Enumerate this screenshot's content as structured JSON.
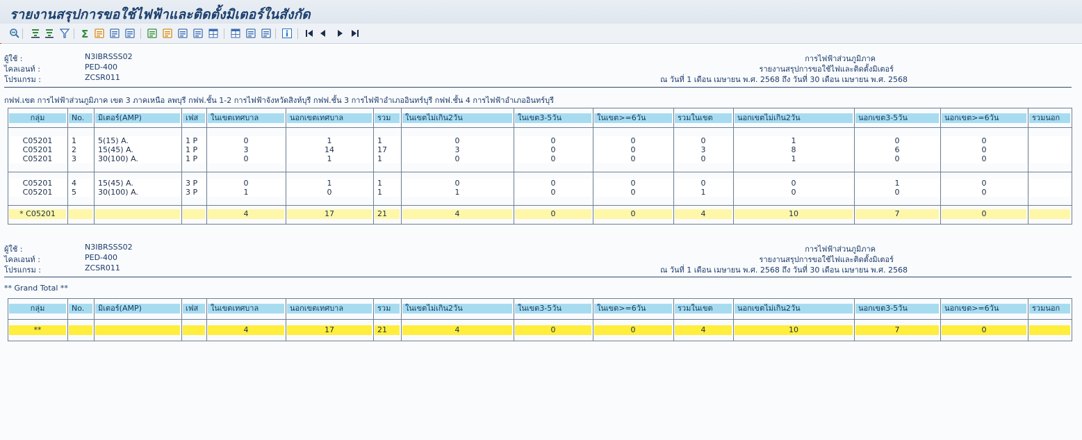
{
  "window": {
    "title": "รายงานสรุปการขอใช้ไฟฟ้าและติดตั้งมิเตอร์ในสังกัด"
  },
  "toolbar": {
    "icons": [
      "details-icon",
      "sort-ascending-icon",
      "sort-descending-icon",
      "filter-icon",
      "sum-icon",
      "subtotal-icon",
      "print-preview-icon",
      "layout-icon",
      "export-spreadsheet-icon",
      "download-icon",
      "send-mail-icon",
      "graphic-icon",
      "abc-analysis-icon",
      "change-layout-icon",
      "select-layout-icon",
      "save-layout-icon",
      "information-icon",
      "first-page-icon",
      "previous-page-icon",
      "next-page-icon",
      "last-page-icon"
    ]
  },
  "header_block_1": {
    "user_label": "ผู้ใช้   :",
    "user_value": "N3IBRSSS02",
    "client_label": "ไคลเอนท์  :",
    "client_value": "PED-400",
    "program_label": "โปรแกรม   :",
    "program_value": "ZCSR011",
    "org": "การไฟฟ้าส่วนภูมิภาค",
    "report_name": "รายงานสรุปการขอใช้ไฟและติดตั้งมิเตอร์",
    "period": "ณ วันที่ 1 เดือน เมษายน พ.ศ. 2568 ถึง วันที่ 30 เดือน เมษายน พ.ศ. 2568"
  },
  "org_line": "กฟฟ.เขต การไฟฟ้าส่วนภูมิภาค เขต 3 ภาคเหนือ ลพบุรี    กฟฟ.ชั้น 1-2 การไฟฟ้าจังหวัดสิงห์บุรี    กฟฟ.ชั้น 3 การไฟฟ้าอำเภออินทร์บุรี    กฟฟ.ชั้น 4 การไฟฟ้าอำเภออินทร์บุรี",
  "columns": [
    "กลุ่ม",
    "No.",
    "มิเตอร์(AMP)",
    "เฟส",
    "ในเขตเทศบาล",
    "นอกเขตเทศบาล",
    "รวม",
    "ในเขตไม่เกิน2วัน",
    "ในเขต3-5วัน",
    "ในเขต>=6วัน",
    "รวมในเขต",
    "นอกเขตไม่เกิน2วัน",
    "นอกเขต3-5วัน",
    "นอกเขต>=6วัน",
    "รวมนอก"
  ],
  "table1": {
    "group_a": [
      {
        "group": "C05201",
        "no": "1",
        "meter": "5(15) A.",
        "phase": "1 P",
        "in_muni": "0",
        "out_muni": "1",
        "total": "1",
        "in_le2": "0",
        "in_3_5": "0",
        "in_ge6": "0",
        "in_total": "0",
        "out_le2": "1",
        "out_3_5": "0",
        "out_ge6": "0"
      },
      {
        "group": "C05201",
        "no": "2",
        "meter": "15(45) A.",
        "phase": "1 P",
        "in_muni": "3",
        "out_muni": "14",
        "total": "17",
        "in_le2": "3",
        "in_3_5": "0",
        "in_ge6": "0",
        "in_total": "3",
        "out_le2": "8",
        "out_3_5": "6",
        "out_ge6": "0"
      },
      {
        "group": "C05201",
        "no": "3",
        "meter": "30(100) A.",
        "phase": "1 P",
        "in_muni": "0",
        "out_muni": "1",
        "total": "1",
        "in_le2": "0",
        "in_3_5": "0",
        "in_ge6": "0",
        "in_total": "0",
        "out_le2": "1",
        "out_3_5": "0",
        "out_ge6": "0"
      }
    ],
    "group_b": [
      {
        "group": "C05201",
        "no": "4",
        "meter": "15(45) A.",
        "phase": "3 P",
        "in_muni": "0",
        "out_muni": "1",
        "total": "1",
        "in_le2": "0",
        "in_3_5": "0",
        "in_ge6": "0",
        "in_total": "0",
        "out_le2": "0",
        "out_3_5": "1",
        "out_ge6": "0"
      },
      {
        "group": "C05201",
        "no": "5",
        "meter": "30(100) A.",
        "phase": "3 P",
        "in_muni": "1",
        "out_muni": "0",
        "total": "1",
        "in_le2": "1",
        "in_3_5": "0",
        "in_ge6": "0",
        "in_total": "1",
        "out_le2": "0",
        "out_3_5": "0",
        "out_ge6": "0"
      }
    ],
    "subtotal": {
      "group": "*  C05201",
      "in_muni": "4",
      "out_muni": "17",
      "total": "21",
      "in_le2": "4",
      "in_3_5": "0",
      "in_ge6": "0",
      "in_total": "4",
      "out_le2": "10",
      "out_3_5": "7",
      "out_ge6": "0"
    }
  },
  "header_block_2": {
    "user_label": "ผู้ใช้   :",
    "user_value": "N3IBRSSS02",
    "client_label": "ไคลเอนท์  :",
    "client_value": "PED-400",
    "program_label": "โปรแกรม   :",
    "program_value": "ZCSR011",
    "org": "การไฟฟ้าส่วนภูมิภาค",
    "report_name": "รายงานสรุปการขอใช้ไฟและติดตั้งมิเตอร์",
    "period": "ณ วันที่ 1 เดือน เมษายน พ.ศ. 2568 ถึง วันที่ 30 เดือน เมษายน พ.ศ. 2568"
  },
  "grand_total_label": "** Grand Total **",
  "table2": {
    "total": {
      "group": "**",
      "in_muni": "4",
      "out_muni": "17",
      "total": "21",
      "in_le2": "4",
      "in_3_5": "0",
      "in_ge6": "0",
      "in_total": "4",
      "out_le2": "10",
      "out_3_5": "7",
      "out_ge6": "0"
    }
  }
}
